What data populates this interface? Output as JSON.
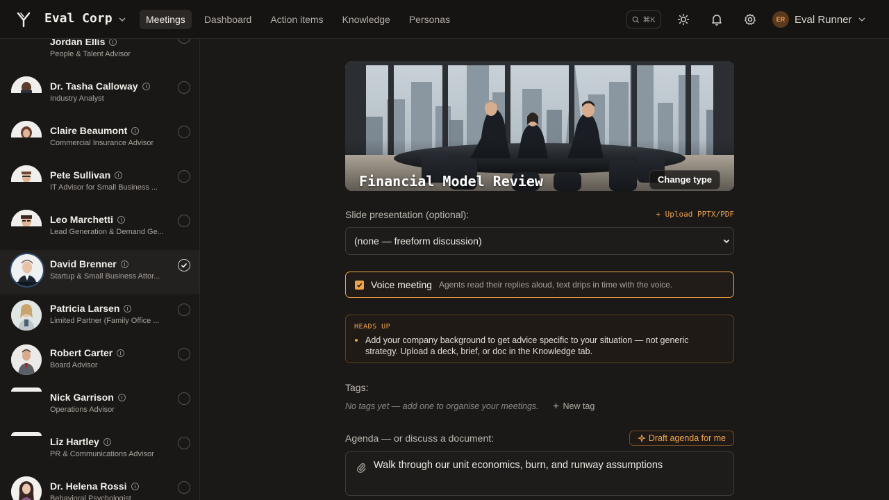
{
  "header": {
    "org_name": "Eval Corp",
    "nav": [
      "Meetings",
      "Dashboard",
      "Action items",
      "Knowledge",
      "Personas"
    ],
    "active_nav": "Meetings",
    "search_shortcut": "⌘K",
    "user_initials": "ER",
    "user_name": "Eval Runner"
  },
  "personas": [
    {
      "name": "Jordan Ellis",
      "role": "People & Talent Advisor",
      "selected": false
    },
    {
      "name": "Dr. Tasha Calloway",
      "role": "Industry Analyst",
      "selected": false
    },
    {
      "name": "Claire Beaumont",
      "role": "Commercial Insurance Advisor",
      "selected": false
    },
    {
      "name": "Pete Sullivan",
      "role": "IT Advisor for Small Business ...",
      "selected": false
    },
    {
      "name": "Leo Marchetti",
      "role": "Lead Generation & Demand Ge...",
      "selected": false
    },
    {
      "name": "David Brenner",
      "role": "Startup & Small Business Attor...",
      "selected": true
    },
    {
      "name": "Patricia Larsen",
      "role": "Limited Partner (Family Office ...",
      "selected": false
    },
    {
      "name": "Robert Carter",
      "role": "Board Advisor",
      "selected": false
    },
    {
      "name": "Nick Garrison",
      "role": "Operations Advisor",
      "selected": false
    },
    {
      "name": "Liz Hartley",
      "role": "PR & Communications Advisor",
      "selected": false
    },
    {
      "name": "Dr. Helena Rossi",
      "role": "Behavioral Psychologist",
      "selected": false
    }
  ],
  "meeting": {
    "title": "Financial Model Review",
    "change_type_label": "Change type",
    "slide_label": "Slide presentation (optional):",
    "upload_label": "+ Upload PPTX/PDF",
    "slide_value": "(none — freeform discussion)",
    "voice_label": "Voice meeting",
    "voice_desc": "Agents read their replies aloud, text drips in time with the voice.",
    "voice_checked": true,
    "heads_up_title": "HEADS UP",
    "heads_up_body": "Add your company background to get advice specific to your situation — not generic strategy. Upload a deck, brief, or doc in the Knowledge tab.",
    "tags_label": "Tags:",
    "no_tags": "No tags yet — add one to organise your meetings.",
    "new_tag": "New tag",
    "agenda_label": "Agenda — or discuss a document:",
    "draft_agenda": "Draft agenda for me",
    "agenda_text": "Walk through our unit economics, burn, and runway assumptions"
  },
  "colors": {
    "accent": "#f0a447",
    "background": "#1b1918",
    "nav_background": "#161413"
  }
}
